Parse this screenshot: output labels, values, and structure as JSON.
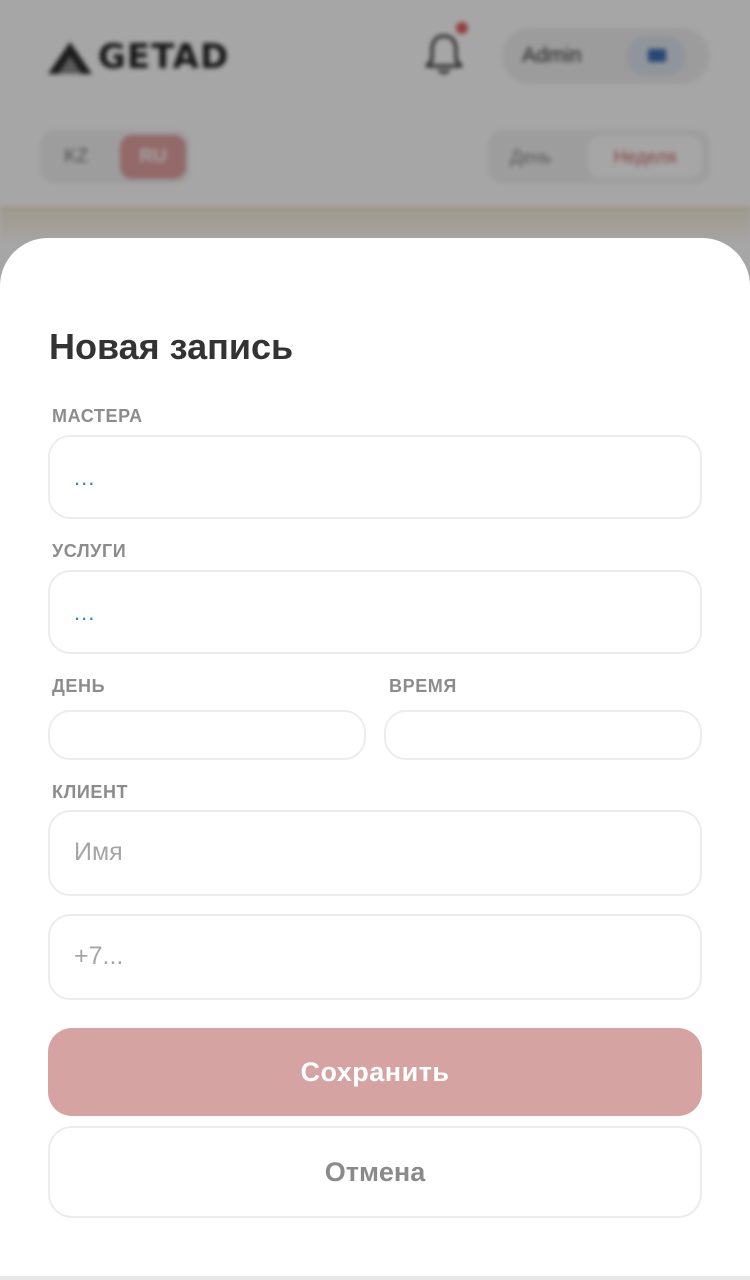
{
  "app": {
    "logo_text": "GETAD",
    "user_name": "Admin",
    "lang": {
      "kz": "KZ",
      "ru": "RU"
    },
    "view": {
      "day": "День",
      "week": "Неделя"
    }
  },
  "colors": {
    "accent": "#d6a3a3",
    "active_tab": "#e3a1a1",
    "value_blue": "#2f86d6",
    "notification_dot": "#e06060"
  },
  "form": {
    "title": "Новая запись",
    "masters": {
      "label": "МАСТЕРА",
      "value": "..."
    },
    "services": {
      "label": "УСЛУГИ",
      "value": "..."
    },
    "day": {
      "label": "ДЕНЬ",
      "value": ""
    },
    "time": {
      "label": "ВРЕМЯ",
      "value": ""
    },
    "client": {
      "label": "КЛИЕНТ",
      "name_placeholder": "Имя",
      "phone_placeholder": "+7..."
    },
    "save_label": "Сохранить",
    "cancel_label": "Отмена"
  }
}
